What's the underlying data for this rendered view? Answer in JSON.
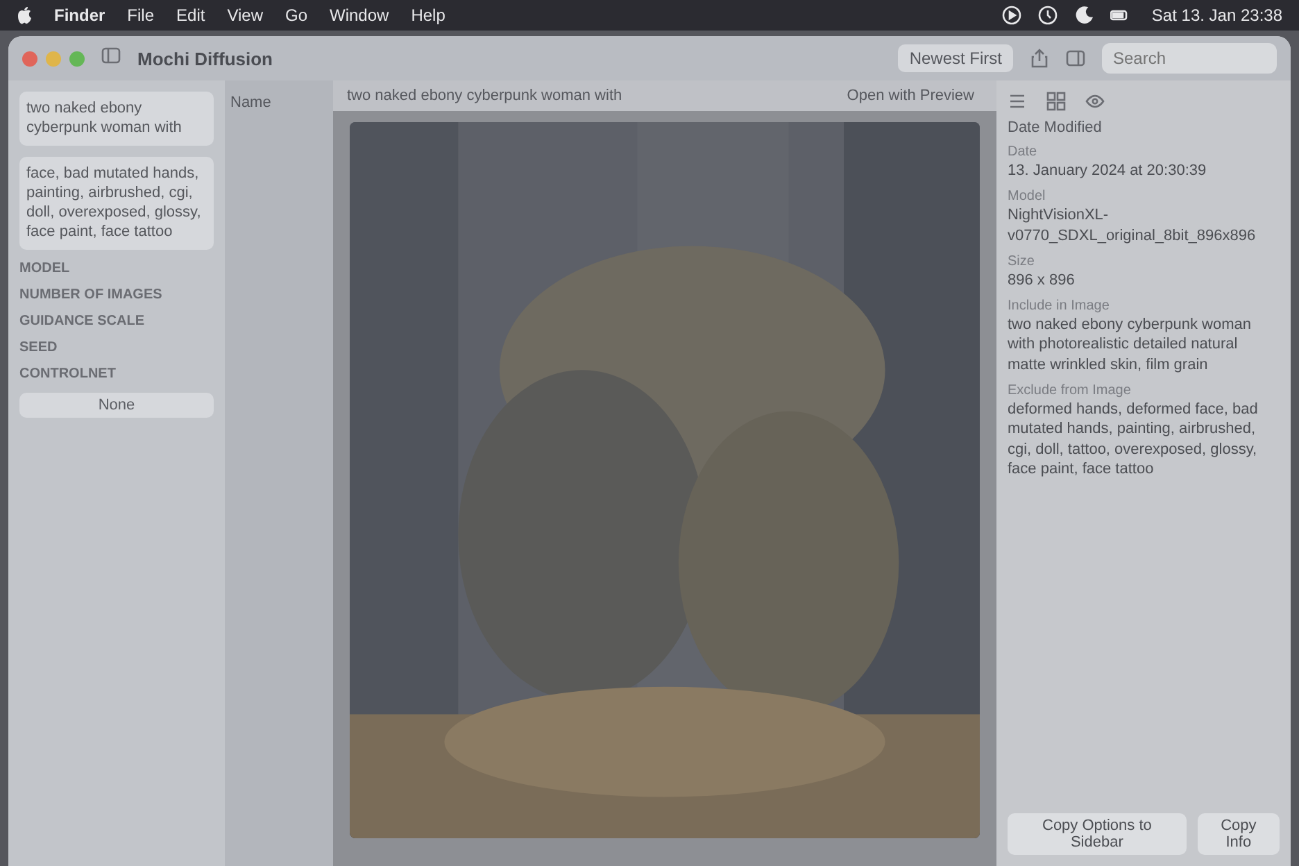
{
  "menu_bar": {
    "app": "Finder",
    "items": [
      "File",
      "Edit",
      "View",
      "Go",
      "Window",
      "Help"
    ],
    "clock": "Sat 13. Jan 23:38"
  },
  "window": {
    "title": "Mochi Diffusion",
    "sort": "Newest First",
    "search": {
      "placeholder": "Search"
    }
  },
  "prompt_bar": {
    "prompt": "two naked ebony cyberpunk woman with",
    "action": "Open with Preview"
  },
  "sidebar": {
    "prompt": "two naked ebony cyberpunk woman with",
    "negative_prompt": "face, bad mutated hands, painting, airbrushed, cgi, doll, overexposed, glossy, face paint, face tattoo",
    "sections": [
      {
        "label": "MODEL"
      },
      {
        "label": "NUMBER OF IMAGES"
      },
      {
        "label": "GUIDANCE SCALE"
      },
      {
        "label": "SEED"
      },
      {
        "label": "CONTROLNET",
        "value": "None"
      }
    ]
  },
  "file_list": {
    "column": "Name"
  },
  "inspector": {
    "column": "Date Modified",
    "fields": [
      {
        "label": "Date",
        "value": "13. January 2024 at 20:30:39"
      },
      {
        "label": "Model",
        "value": "NightVisionXL-v0770_SDXL_original_8bit_896x896"
      },
      {
        "label": "Size",
        "value": "896 x 896"
      },
      {
        "label": "Include in Image",
        "value": "two naked ebony cyberpunk woman with photorealistic detailed natural matte wrinkled skin, film grain"
      },
      {
        "label": "Exclude from Image",
        "value": "deformed hands, deformed face, bad mutated hands, painting, airbrushed, cgi, doll, tattoo, overexposed, glossy, face paint, face tattoo"
      }
    ],
    "buttons": [
      "Copy Options to Sidebar",
      "Copy Info"
    ]
  }
}
